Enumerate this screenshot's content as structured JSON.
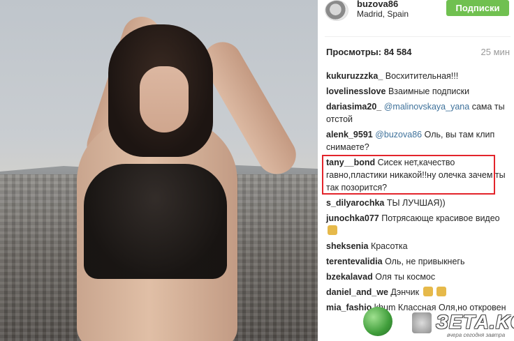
{
  "header": {
    "username": "buzova86",
    "location": "Madrid, Spain",
    "follow_label": "Подписки"
  },
  "stats": {
    "views_label": "Просмотры: 84 584",
    "time": "25 мин"
  },
  "comments": [
    {
      "user": "kukuruzzzka_",
      "text": "Восхитительная!!!"
    },
    {
      "user": "lovelinesslove",
      "text": "Взаимные подписки"
    },
    {
      "user": "dariasima20_",
      "mention": "@malinovskaya_yana",
      "text": "сама ты отстой"
    },
    {
      "user": "alenk_9591",
      "mention": "@buzova86",
      "text": "Оль, вы там клип снимаете?"
    },
    {
      "user": "tany__bond",
      "text": "Сисек нет,качество гавно,пластики никакой!!ну олечка зачем ты так позорится?"
    },
    {
      "user": "s_dilyarochka",
      "text": "ТЫ ЛУЧШАЯ))"
    },
    {
      "user": "junochka077",
      "text": "Потрясающе красивое видео"
    },
    {
      "user": "sheksenia",
      "text": "Красотка"
    },
    {
      "user": "terentevalidia",
      "text": "Оль, не привыкнегь"
    },
    {
      "user": "bzekalavad",
      "text": "Оля ты космос"
    },
    {
      "user": "daniel_and_we",
      "text": "Дэнчик"
    },
    {
      "user": "mia_fashio",
      "text": "khum Классная Оля,но откровен"
    }
  ],
  "watermark": {
    "brand": "ЗЕТА.KG",
    "tagline": "вчера сегодня завтра"
  },
  "colors": {
    "follow_button": "#70c050",
    "highlight_border": "#e3242b",
    "mention": "#3f729b"
  }
}
